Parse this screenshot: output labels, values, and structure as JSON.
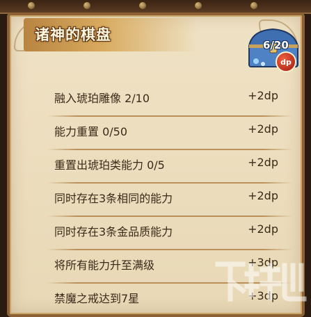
{
  "panel": {
    "title": "诸神的棋盘",
    "progress_text": "6/20",
    "badge_text": "dp",
    "chest_icon": "treasure-chest-icon"
  },
  "tasks": [
    {
      "label": "融入琥珀雕像 2/10",
      "reward": "+2dp"
    },
    {
      "label": "能力重置 0/50",
      "reward": "+2dp"
    },
    {
      "label": "重置出琥珀类能力 0/5",
      "reward": "+2dp"
    },
    {
      "label": "同时存在3条相同的能力",
      "reward": "+2dp"
    },
    {
      "label": "同时存在3条金品质能力",
      "reward": "+2dp"
    },
    {
      "label": "将所有能力升至满级",
      "reward": "+3dp"
    },
    {
      "label": "禁魔之戒达到7星",
      "reward": "+3dp"
    }
  ],
  "colors": {
    "parchment": "#efe2c4",
    "frame": "#8c6234",
    "text": "#3a2a1a",
    "title_banner": "#d8aa5e"
  }
}
